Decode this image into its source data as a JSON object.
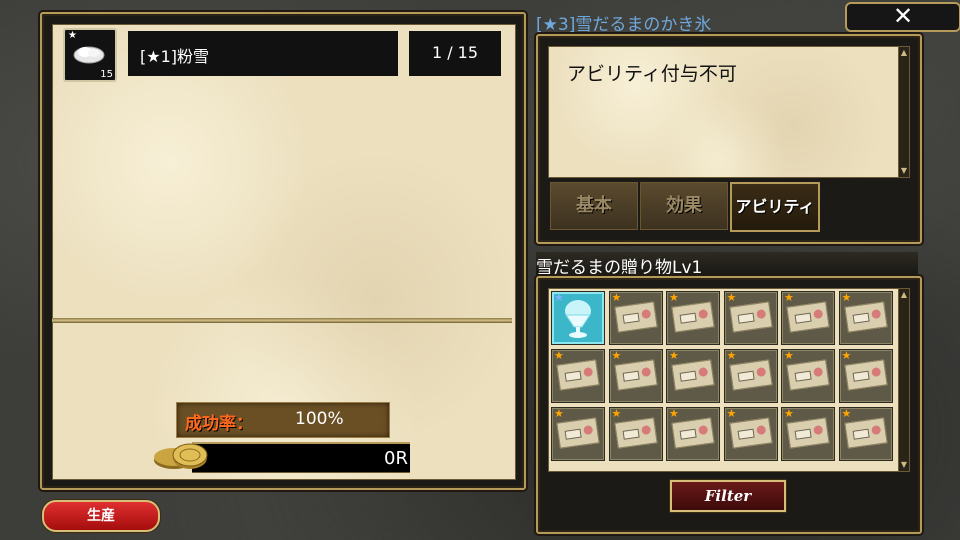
{
  "materials": {
    "item_name": "[★1]粉雪",
    "item_badge": "15",
    "count": "1 / 15"
  },
  "production": {
    "rate_label": "成功率：",
    "rate_value": "100%",
    "cost": "0R",
    "produce_button": "生産"
  },
  "detail": {
    "title": "[★3]雪だるまのかき氷",
    "close_label": "✕",
    "text": "アビリティ付与不可",
    "tabs": [
      {
        "label": "基本",
        "active": false
      },
      {
        "label": "効果",
        "active": false
      },
      {
        "label": "アビリティ",
        "active": true
      }
    ]
  },
  "gift": {
    "title": "雪だるまの贈り物Lv1",
    "filter_button": "Filter",
    "items": [
      {
        "icon": "shaved-ice-icon",
        "star": "★"
      },
      {
        "icon": "ticket-icon",
        "star": "★"
      },
      {
        "icon": "ticket-icon",
        "star": "★"
      },
      {
        "icon": "ticket-icon",
        "star": "★"
      },
      {
        "icon": "ticket-icon",
        "star": "★"
      },
      {
        "icon": "ticket-icon",
        "star": "★"
      },
      {
        "icon": "ticket-icon",
        "star": "★"
      },
      {
        "icon": "ticket-icon",
        "star": "★"
      },
      {
        "icon": "ticket-icon",
        "star": "★"
      },
      {
        "icon": "ticket-icon",
        "star": "★"
      },
      {
        "icon": "ticket-icon",
        "star": "★"
      },
      {
        "icon": "ticket-icon",
        "star": "★"
      },
      {
        "icon": "ticket-icon",
        "star": "★"
      },
      {
        "icon": "ticket-icon",
        "star": "★"
      },
      {
        "icon": "ticket-icon",
        "star": "★"
      },
      {
        "icon": "ticket-icon",
        "star": "★"
      },
      {
        "icon": "ticket-icon",
        "star": "★"
      },
      {
        "icon": "ticket-icon",
        "star": "★"
      }
    ]
  }
}
